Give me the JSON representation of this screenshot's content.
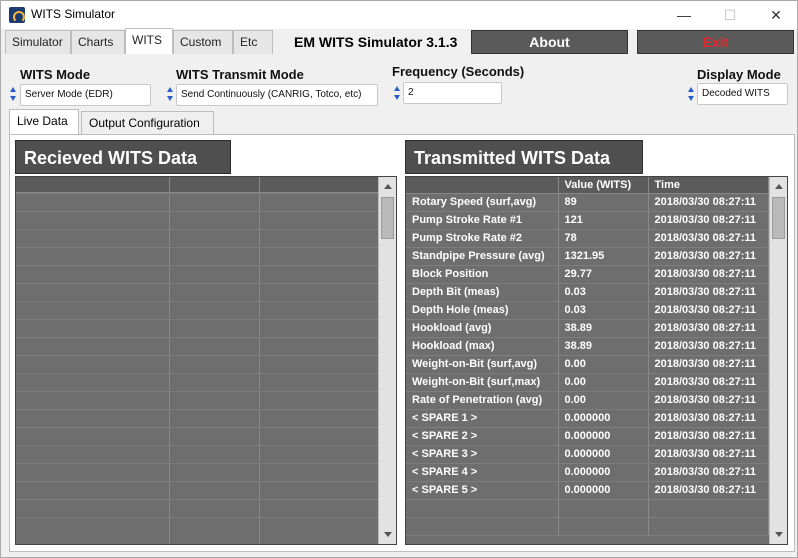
{
  "window": {
    "title": "WITS Simulator"
  },
  "main_tabs": [
    "Simulator",
    "Charts",
    "WITS",
    "Custom",
    "Etc"
  ],
  "active_main_tab": "WITS",
  "app_title": "EM WITS Simulator 3.1.3",
  "buttons": {
    "about": "About",
    "exit": "Exit"
  },
  "settings": {
    "wits_mode": {
      "label": "WITS Mode",
      "value": "Server Mode (EDR)"
    },
    "transmit_mode": {
      "label": "WITS Transmit Mode",
      "value": "Send Continuously (CANRIG, Totco, etc)"
    },
    "frequency": {
      "label": "Frequency (Seconds)",
      "value": "2"
    },
    "display_mode": {
      "label": "Display Mode",
      "value": "Decoded WITS"
    }
  },
  "sub_tabs": [
    "Live Data",
    "Output Configuration"
  ],
  "active_sub_tab": "Live Data",
  "received_panel": {
    "title": "Recieved WITS Data"
  },
  "transmitted_panel": {
    "title": "Transmitted WITS Data",
    "columns": [
      "",
      "Value (WITS)",
      "Time"
    ],
    "rows": [
      [
        "Rotary Speed (surf,avg)",
        "89",
        "2018/03/30 08:27:11"
      ],
      [
        "Pump Stroke Rate #1",
        "121",
        "2018/03/30 08:27:11"
      ],
      [
        "Pump Stroke Rate #2",
        "78",
        "2018/03/30 08:27:11"
      ],
      [
        "Standpipe Pressure (avg)",
        "1321.95",
        "2018/03/30 08:27:11"
      ],
      [
        "Block Position",
        "29.77",
        "2018/03/30 08:27:11"
      ],
      [
        "Depth Bit (meas)",
        "0.03",
        "2018/03/30 08:27:11"
      ],
      [
        "Depth Hole (meas)",
        "0.03",
        "2018/03/30 08:27:11"
      ],
      [
        "Hookload (avg)",
        "38.89",
        "2018/03/30 08:27:11"
      ],
      [
        "Hookload (max)",
        "38.89",
        "2018/03/30 08:27:11"
      ],
      [
        "Weight-on-Bit (surf,avg)",
        "0.00",
        "2018/03/30 08:27:11"
      ],
      [
        "Weight-on-Bit (surf,max)",
        "0.00",
        "2018/03/30 08:27:11"
      ],
      [
        "Rate of Penetration (avg)",
        "0.00",
        "2018/03/30 08:27:11"
      ],
      [
        "< SPARE 1 >",
        "0.000000",
        "2018/03/30 08:27:11"
      ],
      [
        "< SPARE 2 >",
        "0.000000",
        "2018/03/30 08:27:11"
      ],
      [
        "< SPARE 3 >",
        "0.000000",
        "2018/03/30 08:27:11"
      ],
      [
        "< SPARE 4 >",
        "0.000000",
        "2018/03/30 08:27:11"
      ],
      [
        "< SPARE 5 >",
        "0.000000",
        "2018/03/30 08:27:11"
      ]
    ]
  },
  "icons": {
    "app": "wits-app-icon",
    "minimize": "minimize-icon",
    "maximize": "maximize-icon",
    "close": "close-icon"
  },
  "colors": {
    "exit_text": "#e8262c",
    "panel_bg": "#4f4f4f",
    "grid_bg": "#6e6e6e"
  }
}
